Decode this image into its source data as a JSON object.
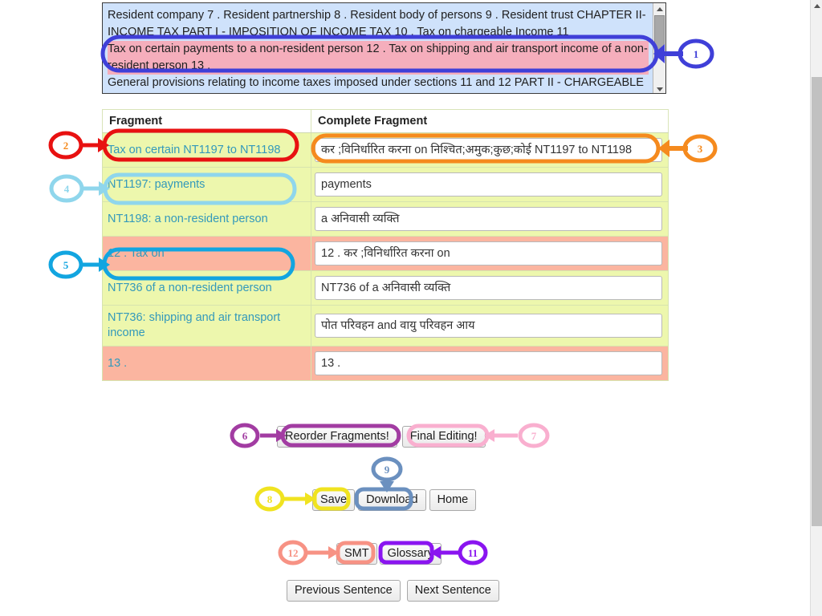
{
  "source_panel": {
    "name": "source-text-area",
    "lines": [
      "Resident company 7 . Resident partnership 8 . Resident body of persons 9 . Resident trust CHAPTER II-",
      "INCOME TAX PART I - IMPOSITION OF INCOME TAX 10 . Tax on chargeable Income 11",
      "General provisions relating to income taxes imposed under sections 11 and 12 PART II - CHARGEABLE"
    ],
    "highlighted_line": "Tax on certain payments to a non-resident person 12 . Tax on shipping and air transport income of a non-resident person 13 .",
    "highlight_color": "#f5aebc",
    "background_color": "#cfe2fb"
  },
  "table": {
    "headers": [
      "Fragment",
      "Complete Fragment"
    ],
    "rows": [
      {
        "fragment": "Tax on certain NT1197 to NT1198",
        "complete": "कर ;विनिर्धारित करना on निश्चित;अमुक;कुछ;कोई NT1197 to NT1198",
        "highlight": "green"
      },
      {
        "fragment": "NT1197: payments",
        "complete": "payments",
        "highlight": "green"
      },
      {
        "fragment": "NT1198: a non-resident person",
        "complete": "a अनिवासी व्यक्ति",
        "highlight": "green"
      },
      {
        "fragment": "12 . Tax on",
        "complete": "12 . कर ;विनिर्धारित करना on",
        "highlight": "salmon"
      },
      {
        "fragment": "NT736 of a non-resident person",
        "complete": "NT736 of a अनिवासी व्यक्ति",
        "highlight": "green"
      },
      {
        "fragment": "NT736: shipping and air transport income",
        "complete": "पोत परिवहन and वायु परिवहन आय",
        "highlight": "green"
      },
      {
        "fragment": "13 .",
        "complete": "13 .",
        "highlight": "salmon"
      }
    ],
    "row_colors": {
      "green": "#edf7ad",
      "salmon": "#fbb5a0"
    },
    "fragment_text_color": "#3399bb"
  },
  "buttons": {
    "reorder_fragments": "Reorder Fragments!",
    "final_editing": "Final Editing!",
    "save": "Save",
    "download": "Download",
    "home": "Home",
    "smt": "SMT",
    "glossary": "Glossary",
    "previous_sentence": "Previous Sentence",
    "next_sentence": "Next Sentence"
  },
  "annotations": [
    {
      "number": "1",
      "color": "#3f3fd8",
      "target": "highlighted-source-line"
    },
    {
      "number": "2",
      "color": "#e81111",
      "target": "fragment-cell-row-1"
    },
    {
      "number": "3",
      "color": "#f58a1e",
      "target": "complete-input-row-1"
    },
    {
      "number": "4",
      "color": "#8fd6ec",
      "target": "fragment-cell-row-2"
    },
    {
      "number": "5",
      "color": "#12a5e0",
      "target": "fragment-cell-row-4"
    },
    {
      "number": "6",
      "color": "#a23ca2",
      "target": "reorder-fragments-button"
    },
    {
      "number": "7",
      "color": "#f9afcf",
      "target": "final-editing-button"
    },
    {
      "number": "8",
      "color": "#f0e320",
      "target": "save-button"
    },
    {
      "number": "9",
      "color": "#6b90bf",
      "target": "download-button"
    },
    {
      "number": "11",
      "color": "#8a14f0",
      "target": "glossary-button"
    },
    {
      "number": "12",
      "color": "#f79284",
      "target": "smt-button"
    }
  ],
  "scrollbars": {
    "browser": "page-scrollbar",
    "source": "source-text-scrollbar"
  }
}
